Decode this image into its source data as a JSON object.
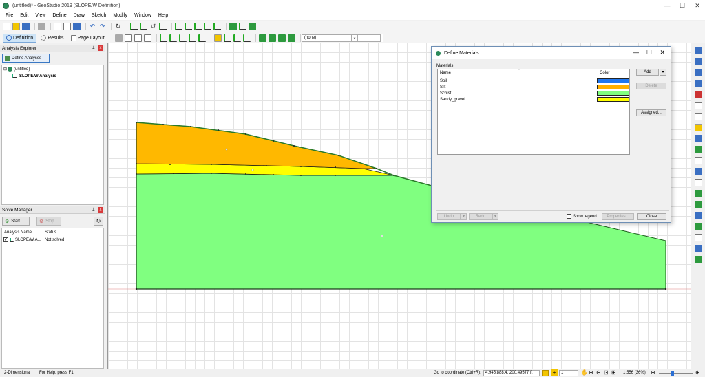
{
  "window": {
    "title": "(untitled)* - GeoStudio 2019 (SLOPE/W Definition)",
    "min": "—",
    "max": "☐",
    "close": "✕"
  },
  "menu": [
    "File",
    "Edit",
    "View",
    "Define",
    "Draw",
    "Sketch",
    "Modify",
    "Window",
    "Help"
  ],
  "toolbar2": {
    "definition": "Definition",
    "results": "Results",
    "page_layout": "Page Layout",
    "combo_value": "(none)"
  },
  "analysis_explorer": {
    "title": "Analysis Explorer",
    "define_button": "Define Analyses",
    "tree_root": "(untitled)",
    "tree_child": "SLOPE/W Analysis"
  },
  "solve_manager": {
    "title": "Solve Manager",
    "start": "Start",
    "stop": "Stop",
    "col_name": "Analysis Name",
    "col_status": "Status",
    "row_name": "SLOPE/W A...",
    "row_status": "Not solved"
  },
  "dialog": {
    "title": "Define Materials",
    "group_label": "Materials",
    "col_name": "Name",
    "col_color": "Color",
    "materials": [
      {
        "name": "Soil",
        "color": "#1f77f0"
      },
      {
        "name": "Silt",
        "color": "#ffb000"
      },
      {
        "name": "Schist",
        "color": "#80ff80"
      },
      {
        "name": "Sandy_gravel",
        "color": "#ffff00"
      }
    ],
    "add": "Add",
    "delete": "Delete",
    "assigned": "Assigned...",
    "undo": "Undo",
    "redo": "Redo",
    "show_legend": "Show legend",
    "properties": "Properties...",
    "close": "Close"
  },
  "status": {
    "mode": "2-Dimensional",
    "help": "For Help, press F1",
    "goto_label": "Go to coordinate (Ctrl+R):",
    "coord": "4,945,888.4, 200.49577 ft",
    "snap_value": "1",
    "scale": "1:556 (36%)"
  },
  "colors": {
    "silt": "#ffb800",
    "sandy_gravel": "#ffff00",
    "schist": "#80ff80",
    "outline": "#2a7a2a"
  }
}
